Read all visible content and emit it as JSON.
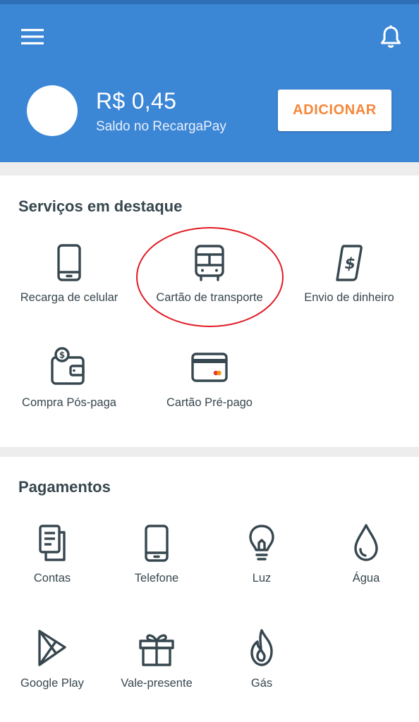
{
  "header": {
    "menu_icon": "hamburger-menu-icon",
    "notification_icon": "bell-icon",
    "balance": "R$ 0,45",
    "balance_caption": "Saldo no RecargaPay",
    "add_button": "ADICIONAR",
    "colors": {
      "background": "#3c86d6",
      "button_text": "#f5873b"
    }
  },
  "services": {
    "title": "Serviços em destaque",
    "items": [
      {
        "label": "Recarga de celular",
        "icon": "phone-icon"
      },
      {
        "label": "Cartão de transporte",
        "icon": "bus-icon"
      },
      {
        "label": "Envio de dinheiro",
        "icon": "money-transfer-icon"
      },
      {
        "label": "Compra Pós-paga",
        "icon": "wallet-icon"
      },
      {
        "label": "Cartão Pré-pago",
        "icon": "credit-card-icon"
      }
    ]
  },
  "payments": {
    "title": "Pagamentos",
    "items": [
      {
        "label": "Contas",
        "icon": "bills-icon"
      },
      {
        "label": "Telefone",
        "icon": "phone-icon"
      },
      {
        "label": "Luz",
        "icon": "lightbulb-icon"
      },
      {
        "label": "Água",
        "icon": "water-drop-icon"
      },
      {
        "label": "Google Play",
        "icon": "google-play-icon"
      },
      {
        "label": "Vale-presente",
        "icon": "gift-icon"
      },
      {
        "label": "Gás",
        "icon": "flame-icon"
      }
    ]
  },
  "annotation": {
    "color": "#e01b24"
  }
}
